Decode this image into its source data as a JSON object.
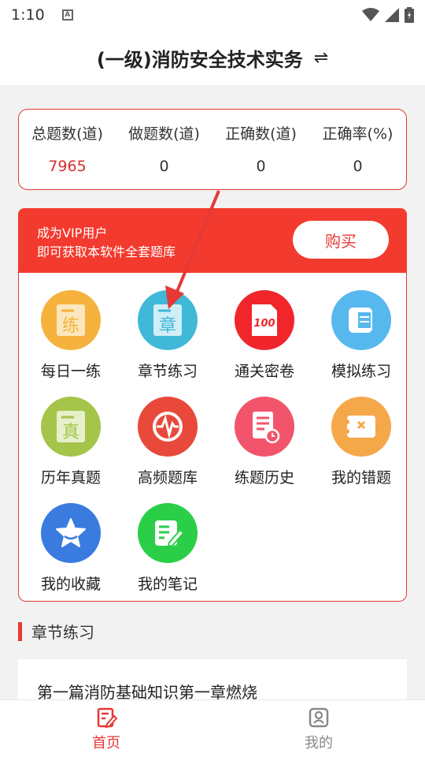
{
  "status_bar": {
    "time": "1:10",
    "icons": [
      "a-icon",
      "wifi-icon",
      "signal-icon",
      "battery-icon"
    ]
  },
  "header": {
    "title": "(一级)消防安全技术实务",
    "swap_icon": "⇌"
  },
  "stats": [
    {
      "label": "总题数(道)",
      "value": "7965",
      "highlight": true
    },
    {
      "label": "做题数(道)",
      "value": "0",
      "highlight": false
    },
    {
      "label": "正确数(道)",
      "value": "0",
      "highlight": false
    },
    {
      "label": "正确率(%)",
      "value": "0",
      "highlight": false
    }
  ],
  "vip": {
    "line1": "成为VIP用户",
    "line2": "即可获取本软件全套题库",
    "buy_label": "购买"
  },
  "features": [
    {
      "label": "每日一练",
      "icon": "daily-practice-icon",
      "color": "#f5b23c",
      "glyph": "练"
    },
    {
      "label": "章节练习",
      "icon": "chapter-practice-icon",
      "color": "#40b8d8",
      "glyph": "章"
    },
    {
      "label": "通关密卷",
      "icon": "secret-paper-icon",
      "color": "#f0262b",
      "glyph": "100"
    },
    {
      "label": "模拟练习",
      "icon": "mock-exam-icon",
      "color": "#57b8ee",
      "glyph": ""
    },
    {
      "label": "历年真题",
      "icon": "past-exams-icon",
      "color": "#a4c54a",
      "glyph": "真"
    },
    {
      "label": "高频题库",
      "icon": "high-frequency-icon",
      "color": "#e8493a",
      "glyph": ""
    },
    {
      "label": "练题历史",
      "icon": "practice-history-icon",
      "color": "#f2546b",
      "glyph": ""
    },
    {
      "label": "我的错题",
      "icon": "wrong-questions-icon",
      "color": "#f5a84a",
      "glyph": ""
    },
    {
      "label": "我的收藏",
      "icon": "favorites-icon",
      "color": "#3a7be0",
      "glyph": ""
    },
    {
      "label": "我的笔记",
      "icon": "notes-icon",
      "color": "#2bcf47",
      "glyph": ""
    }
  ],
  "section": {
    "title": "章节练习"
  },
  "chapter_list": [
    {
      "title": "第一篇消防基础知识第一章燃烧"
    }
  ],
  "tabbar": {
    "tabs": [
      {
        "label": "首页",
        "icon": "home-icon",
        "active": true
      },
      {
        "label": "我的",
        "icon": "profile-icon",
        "active": false
      }
    ]
  },
  "colors": {
    "accent": "#e53935",
    "vip_bg": "#f33a2e"
  }
}
